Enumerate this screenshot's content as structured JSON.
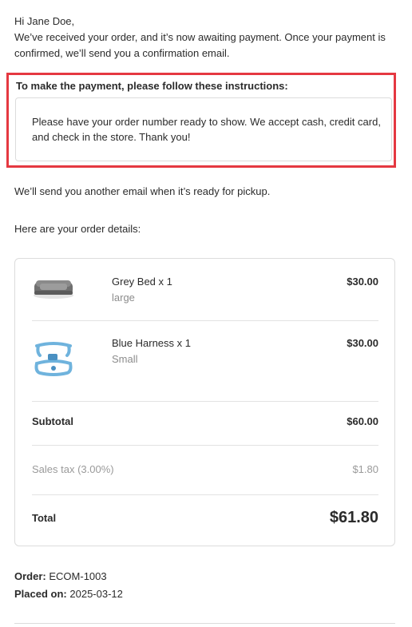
{
  "greeting": {
    "salutation": "Hi Jane Doe,",
    "body": "We’ve received your order, and it’s now awaiting payment. Once your payment is confirmed, we’ll send you a confirmation email."
  },
  "payment_instructions": {
    "heading": "To make the payment, please follow these instructions:",
    "text": "Please have your order number ready to show. We accept cash, credit card, and check in the store. Thank you!",
    "highlight_color": "#e53841"
  },
  "ready_note": "We’ll send you another email when it’s ready for pickup.",
  "details_intro": "Here are your order details:",
  "items": [
    {
      "name": "Grey Bed x 1",
      "variant": "large",
      "price": "$30.00",
      "thumbnail": "grey-pet-bed-image"
    },
    {
      "name": "Blue Harness x 1",
      "variant": "Small",
      "price": "$30.00",
      "thumbnail": "blue-harness-image"
    }
  ],
  "summary": {
    "subtotal_label": "Subtotal",
    "subtotal_value": "$60.00",
    "tax_label": "Sales tax (3.00%)",
    "tax_value": "$1.80",
    "total_label": "Total",
    "total_value": "$61.80"
  },
  "order_meta": {
    "order_label": "Order:",
    "order_number": "ECOM-1003",
    "placed_label": "Placed on:",
    "placed_date": "2025-03-12"
  }
}
